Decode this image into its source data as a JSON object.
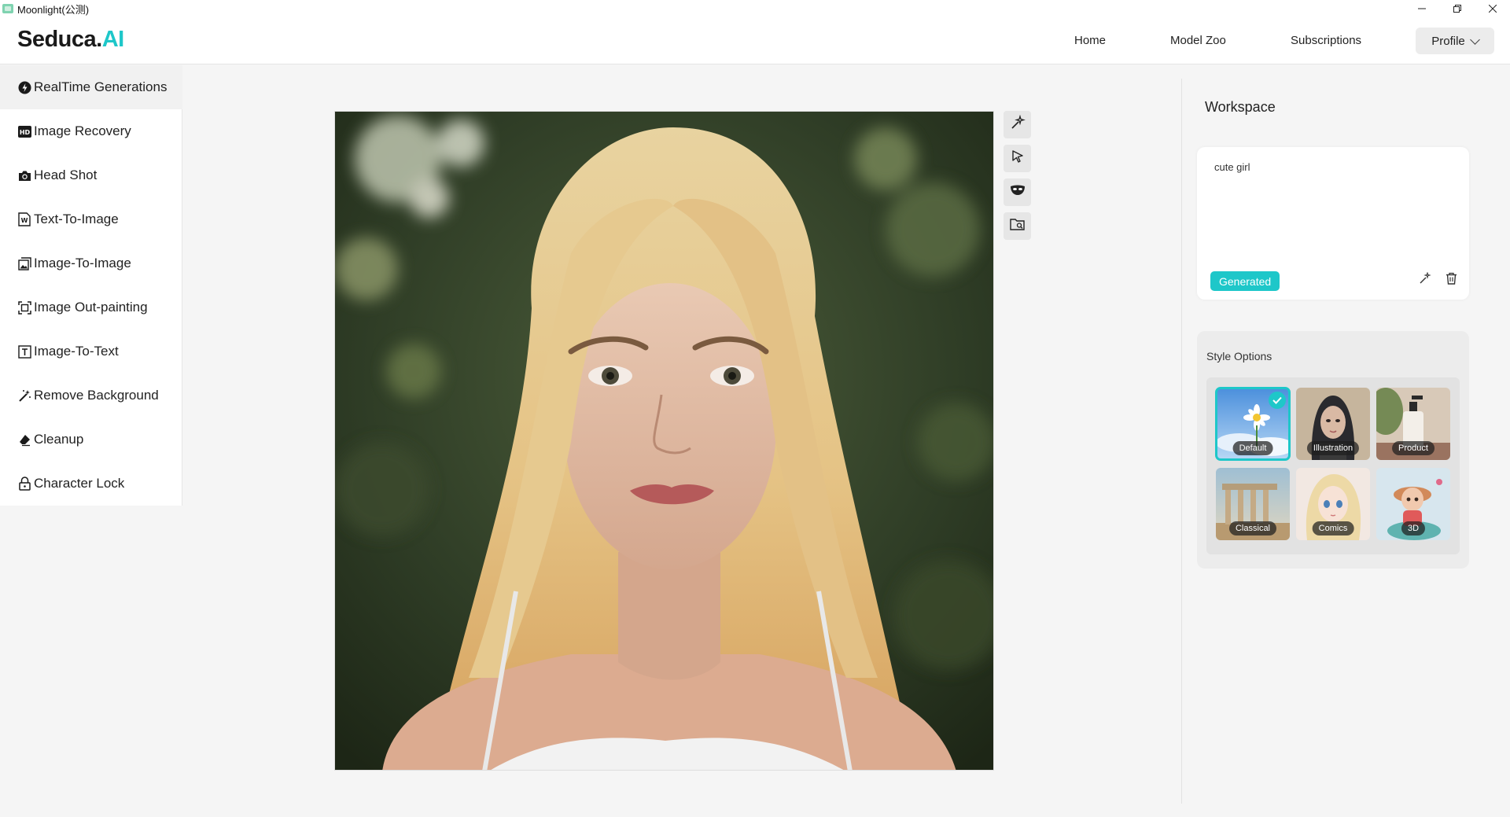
{
  "window": {
    "title": "Moonlight(公测)",
    "controls": [
      "minimize-icon",
      "restore-icon",
      "close-icon"
    ]
  },
  "header": {
    "brand_main": "Seduca.",
    "brand_accent": "AI",
    "nav": [
      {
        "label": "Home"
      },
      {
        "label": "Model Zoo"
      },
      {
        "label": "Subscriptions"
      }
    ],
    "profile_label": "Profile"
  },
  "sidebar": {
    "items": [
      {
        "label": "RealTime Generations",
        "icon": "realtime-icon",
        "active": true
      },
      {
        "label": "Image Recovery",
        "icon": "hd-icon"
      },
      {
        "label": "Head Shot",
        "icon": "camera-icon"
      },
      {
        "label": "Text-To-Image",
        "icon": "word-doc-icon"
      },
      {
        "label": "Image-To-Image",
        "icon": "image-stack-icon"
      },
      {
        "label": "Image Out-painting",
        "icon": "expand-frame-icon"
      },
      {
        "label": "Image-To-Text",
        "icon": "text-box-icon"
      },
      {
        "label": "Remove Background",
        "icon": "magic-wand-icon"
      },
      {
        "label": "Cleanup",
        "icon": "eraser-icon"
      },
      {
        "label": "Character Lock",
        "icon": "lock-icon"
      }
    ]
  },
  "canvas": {
    "tools": [
      "magic-sparkle-icon",
      "pointer-icon",
      "mask-icon",
      "folder-search-icon"
    ]
  },
  "workspace": {
    "title": "Workspace",
    "prompt": "cute girl",
    "status_badge": "Generated",
    "actions": [
      "magic-wand-icon",
      "trash-icon"
    ]
  },
  "style_options": {
    "title": "Style Options",
    "selected": "Default",
    "styles": [
      {
        "label": "Default"
      },
      {
        "label": "Illustration"
      },
      {
        "label": "Product"
      },
      {
        "label": "Classical"
      },
      {
        "label": "Comics"
      },
      {
        "label": "3D"
      }
    ]
  },
  "colors": {
    "accent": "#1ec7c9",
    "brand_dark": "#1a1a1a"
  }
}
